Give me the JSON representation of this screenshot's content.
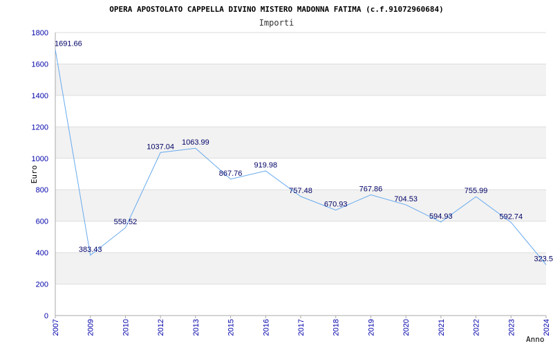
{
  "chart_data": {
    "type": "line",
    "title": "OPERA APOSTOLATO CAPPELLA DIVINO MISTERO MADONNA FATIMA (c.f.91072960684)",
    "subtitle": "Importi",
    "xlabel": "Anno",
    "ylabel": "Euro",
    "ylim": [
      0,
      1800
    ],
    "yticks": [
      0,
      200,
      400,
      600,
      800,
      1000,
      1200,
      1400,
      1600,
      1800
    ],
    "grid": true,
    "categories": [
      "2007",
      "2009",
      "2010",
      "2012",
      "2013",
      "2015",
      "2016",
      "2017",
      "2018",
      "2019",
      "2020",
      "2021",
      "2022",
      "2023",
      "2024"
    ],
    "values": [
      1691.66,
      383.43,
      558.52,
      1037.04,
      1063.99,
      867.76,
      919.98,
      757.48,
      670.93,
      767.86,
      704.53,
      594.93,
      755.99,
      592.74,
      323.5
    ],
    "labels": [
      "1691.66",
      "383.43",
      "558.52",
      "1037.04",
      "1063.99",
      "867.76",
      "919.98",
      "757.48",
      "670.93",
      "767.86",
      "704.53",
      "594.93",
      "755.99",
      "592.74",
      "323.5"
    ],
    "colors": {
      "line": "#66aaee",
      "band": "#f2f2f2",
      "grid": "#dddddd",
      "axis": "#aaaaaa",
      "tick_text": "#0000aa",
      "label_text": "#000066"
    }
  }
}
